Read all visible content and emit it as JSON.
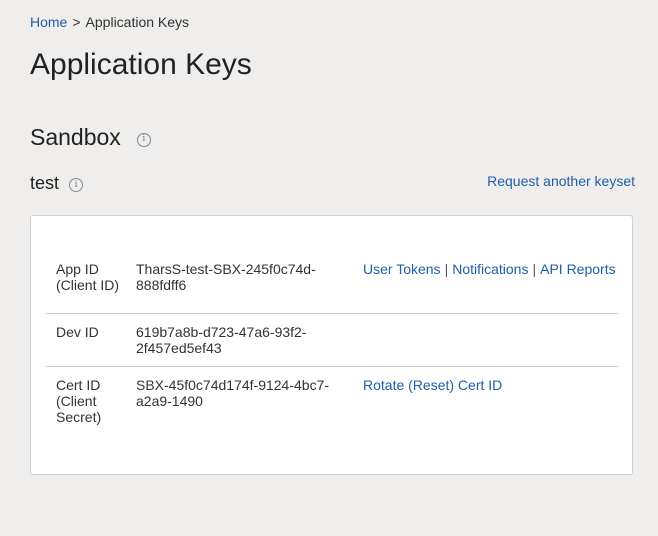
{
  "breadcrumb": {
    "home": "Home",
    "separator": ">",
    "current": "Application Keys"
  },
  "page_title": "Application Keys",
  "environment": {
    "title": "Sandbox",
    "info_icon": "info-icon"
  },
  "keyset": {
    "name": "test",
    "request_link": "Request another keyset"
  },
  "keys": {
    "app_id": {
      "label": "App ID (Client ID)",
      "value": "TharsS-test-SBX-245f0c74d-888fdff6",
      "links": [
        "User Tokens",
        "Notifications",
        "API Reports"
      ]
    },
    "dev_id": {
      "label": "Dev ID",
      "value": "619b7a8b-d723-47a6-93f2-2f457ed5ef43"
    },
    "cert_id": {
      "label": "Cert ID (Client Secret)",
      "value": "SBX-45f0c74d174f-9124-4bc7-a2a9-1490",
      "link": "Rotate (Reset) Cert ID"
    }
  },
  "colors": {
    "background": "#efeeec",
    "link": "#1f5ea8",
    "text": "#333333"
  }
}
